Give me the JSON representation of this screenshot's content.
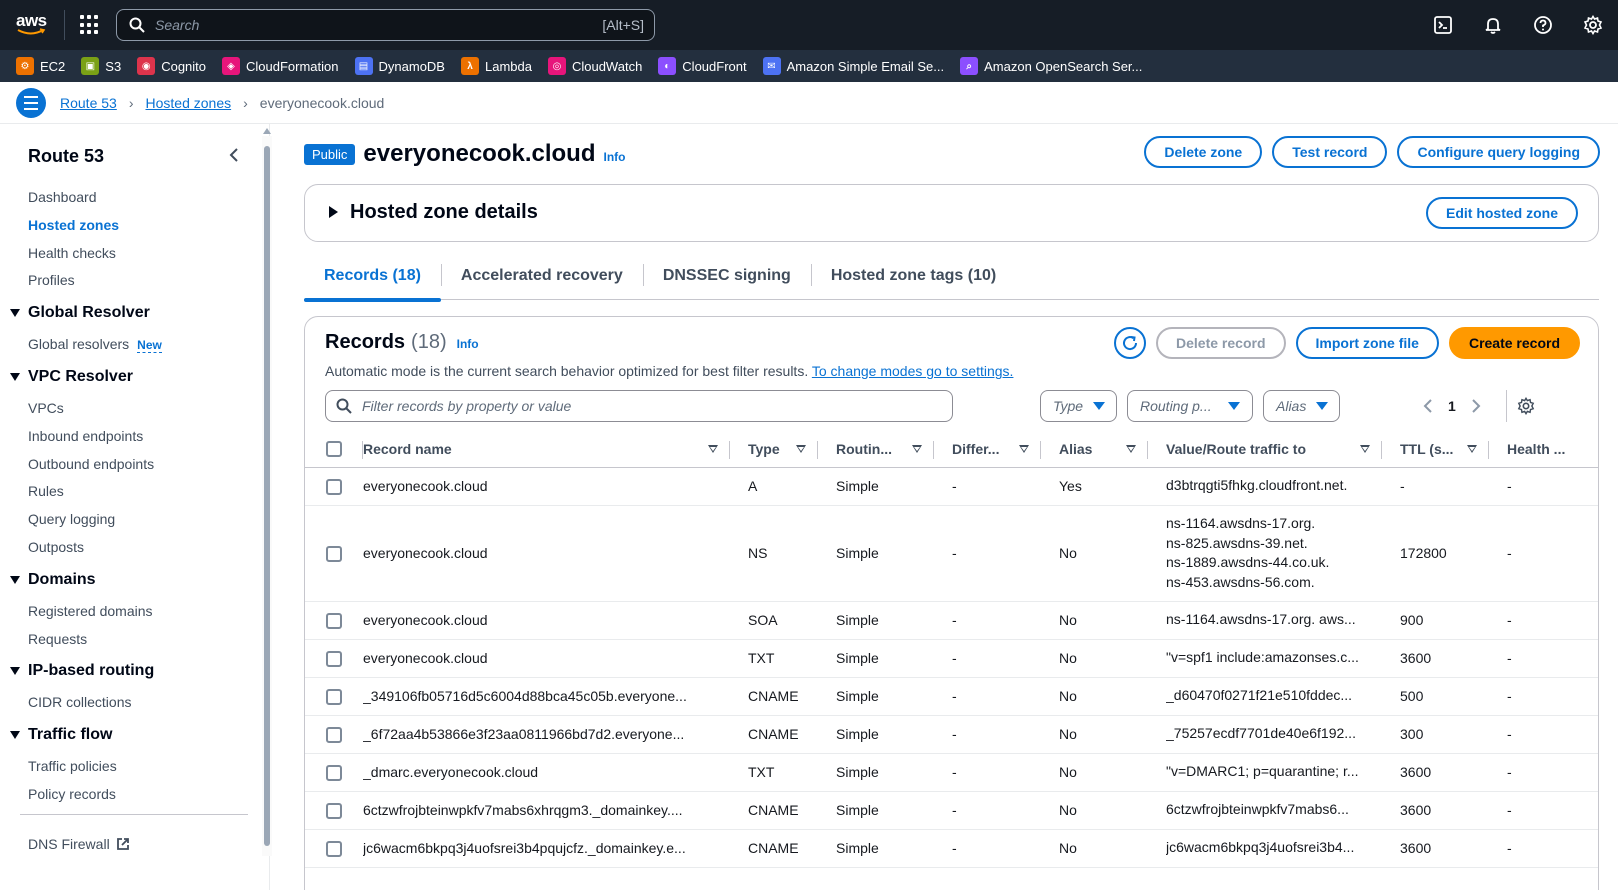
{
  "topnav": {
    "logo_text": "aws",
    "search_placeholder": "Search",
    "search_shortcut": "[Alt+S]",
    "icons": [
      "cloudshell-icon",
      "bell-icon",
      "help-icon",
      "settings-icon"
    ]
  },
  "favorites": [
    {
      "label": "EC2",
      "color": "#ed7100",
      "glyph": "⚙"
    },
    {
      "label": "S3",
      "color": "#7aa116",
      "glyph": "▣"
    },
    {
      "label": "Cognito",
      "color": "#dd344c",
      "glyph": "◉"
    },
    {
      "label": "CloudFormation",
      "color": "#e7157b",
      "glyph": "◈"
    },
    {
      "label": "DynamoDB",
      "color": "#4d72f3",
      "glyph": "▤"
    },
    {
      "label": "Lambda",
      "color": "#ed7100",
      "glyph": "λ"
    },
    {
      "label": "CloudWatch",
      "color": "#e7157b",
      "glyph": "◎"
    },
    {
      "label": "CloudFront",
      "color": "#8c4fff",
      "glyph": "◐"
    },
    {
      "label": "Amazon Simple Email Se...",
      "color": "#4d72f3",
      "glyph": "✉"
    },
    {
      "label": "Amazon OpenSearch Ser...",
      "color": "#8c4fff",
      "glyph": "⌕"
    }
  ],
  "breadcrumb": {
    "items": [
      "Route 53",
      "Hosted zones"
    ],
    "current": "everyonecook.cloud"
  },
  "sidebar": {
    "title": "Route 53",
    "top_items": [
      "Dashboard",
      "Hosted zones",
      "Health checks",
      "Profiles"
    ],
    "active_item": "Hosted zones",
    "sections": [
      {
        "title": "Global Resolver",
        "items": [
          "Global resolvers"
        ],
        "new_badge": "New"
      },
      {
        "title": "VPC Resolver",
        "items": [
          "VPCs",
          "Inbound endpoints",
          "Outbound endpoints",
          "Rules",
          "Query logging",
          "Outposts"
        ]
      },
      {
        "title": "Domains",
        "items": [
          "Registered domains",
          "Requests"
        ]
      },
      {
        "title": "IP-based routing",
        "items": [
          "CIDR collections"
        ]
      },
      {
        "title": "Traffic flow",
        "items": [
          "Traffic policies",
          "Policy records"
        ]
      }
    ],
    "footer_item": "DNS Firewall"
  },
  "page": {
    "badge": "Public",
    "title": "everyonecook.cloud",
    "info": "Info",
    "buttons": {
      "delete_zone": "Delete zone",
      "test_record": "Test record",
      "configure_logging": "Configure query logging"
    }
  },
  "details": {
    "title": "Hosted zone details",
    "edit_button": "Edit hosted zone"
  },
  "tabs": [
    "Records (18)",
    "Accelerated recovery",
    "DNSSEC signing",
    "Hosted zone tags (10)"
  ],
  "records": {
    "title": "Records",
    "count": "(18)",
    "info": "Info",
    "description": "Automatic mode is the current search behavior optimized for best filter results.",
    "settings_link": "To change modes go to settings.",
    "buttons": {
      "delete": "Delete record",
      "import": "Import zone file",
      "create": "Create record"
    },
    "filter_placeholder": "Filter records by property or value",
    "selects": {
      "type": "Type",
      "routing": "Routing p...",
      "alias": "Alias"
    },
    "page_number": "1",
    "columns": [
      "Record name",
      "Type",
      "Routin...",
      "Differ...",
      "Alias",
      "Value/Route traffic to",
      "TTL (s...",
      "Health ..."
    ],
    "rows": [
      {
        "name": "everyonecook.cloud",
        "type": "A",
        "routing": "Simple",
        "diff": "-",
        "alias": "Yes",
        "value": [
          "d3btrqgti5fhkg.cloudfront.net."
        ],
        "ttl": "-",
        "health": "-"
      },
      {
        "name": "everyonecook.cloud",
        "type": "NS",
        "routing": "Simple",
        "diff": "-",
        "alias": "No",
        "value": [
          "ns-1164.awsdns-17.org.",
          "ns-825.awsdns-39.net.",
          "ns-1889.awsdns-44.co.uk.",
          "ns-453.awsdns-56.com."
        ],
        "ttl": "172800",
        "health": "-"
      },
      {
        "name": "everyonecook.cloud",
        "type": "SOA",
        "routing": "Simple",
        "diff": "-",
        "alias": "No",
        "value": [
          "ns-1164.awsdns-17.org. aws..."
        ],
        "ttl": "900",
        "health": "-"
      },
      {
        "name": "everyonecook.cloud",
        "type": "TXT",
        "routing": "Simple",
        "diff": "-",
        "alias": "No",
        "value": [
          "\"v=spf1 include:amazonses.c..."
        ],
        "ttl": "3600",
        "health": "-"
      },
      {
        "name": "_349106fb05716d5c6004d88bca45c05b.everyone...",
        "type": "CNAME",
        "routing": "Simple",
        "diff": "-",
        "alias": "No",
        "value": [
          "_d60470f0271f21e510fddec..."
        ],
        "ttl": "500",
        "health": "-"
      },
      {
        "name": "_6f72aa4b53866e3f23aa0811966bd7d2.everyone...",
        "type": "CNAME",
        "routing": "Simple",
        "diff": "-",
        "alias": "No",
        "value": [
          "_75257ecdf7701de40e6f192..."
        ],
        "ttl": "300",
        "health": "-"
      },
      {
        "name": "_dmarc.everyonecook.cloud",
        "type": "TXT",
        "routing": "Simple",
        "diff": "-",
        "alias": "No",
        "value": [
          "\"v=DMARC1; p=quarantine; r..."
        ],
        "ttl": "3600",
        "health": "-"
      },
      {
        "name": "6ctzwfrojbteinwpkfv7mabs6xhrqgm3._domainkey....",
        "type": "CNAME",
        "routing": "Simple",
        "diff": "-",
        "alias": "No",
        "value": [
          "6ctzwfrojbteinwpkfv7mabs6..."
        ],
        "ttl": "3600",
        "health": "-"
      },
      {
        "name": "jc6wacm6bkpq3j4uofsrei3b4pqujcfz._domainkey.e...",
        "type": "CNAME",
        "routing": "Simple",
        "diff": "-",
        "alias": "No",
        "value": [
          "jc6wacm6bkpq3j4uofsrei3b4..."
        ],
        "ttl": "3600",
        "health": "-"
      }
    ]
  }
}
